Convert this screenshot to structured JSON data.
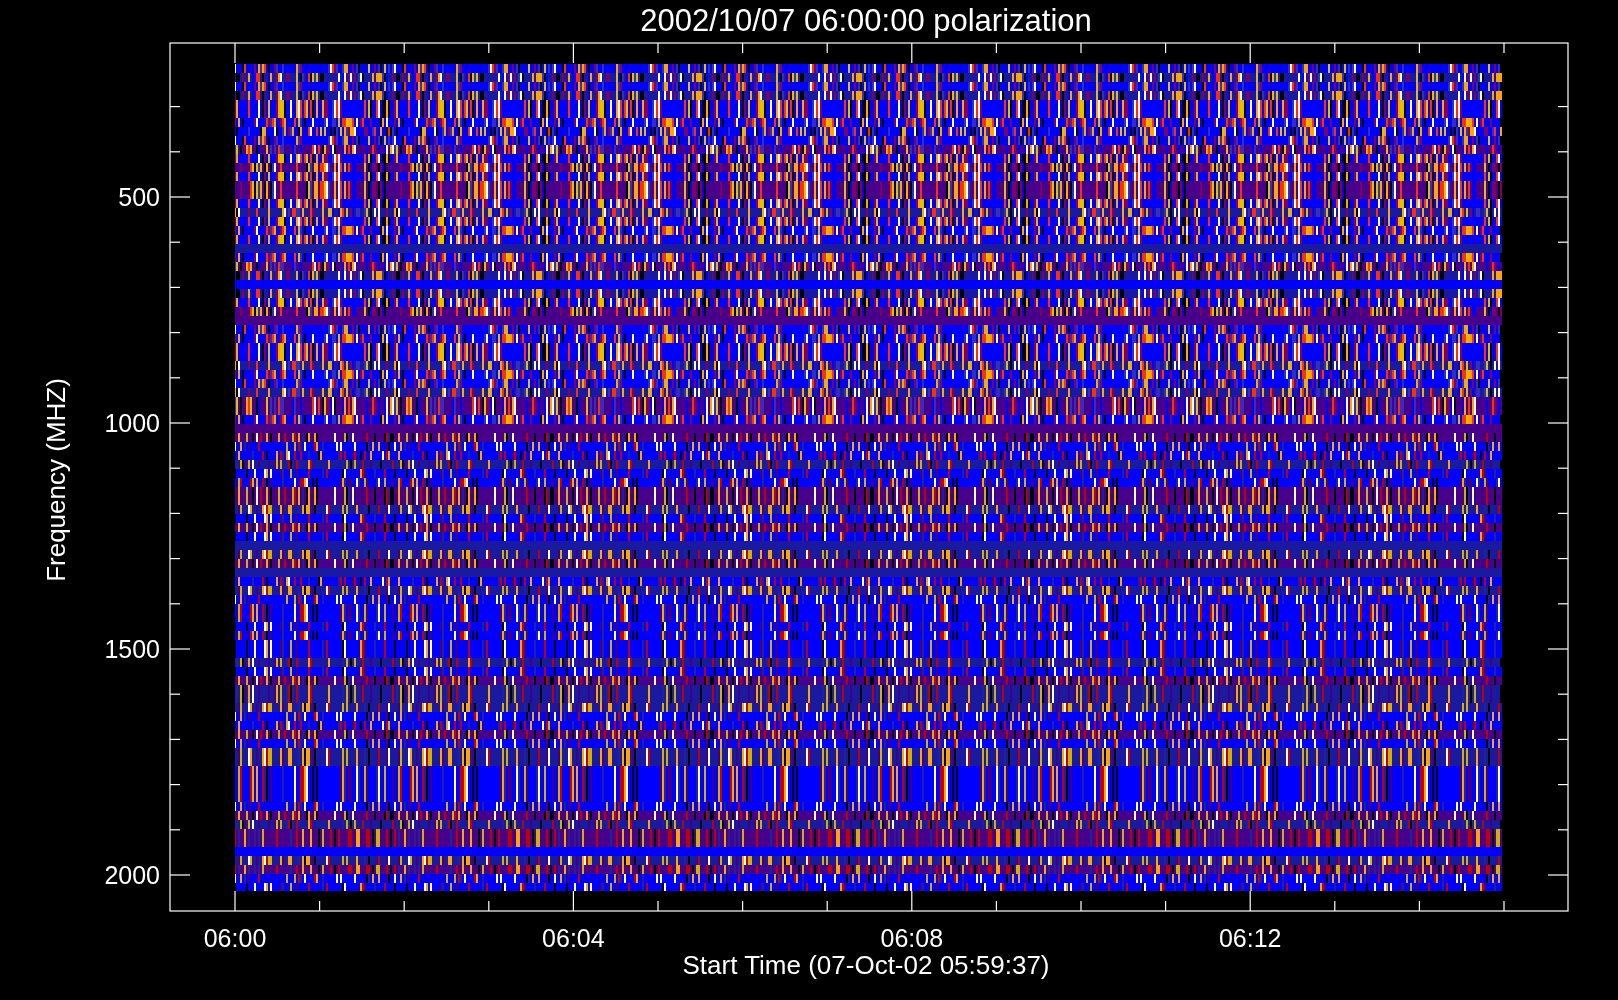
{
  "title": "2002/10/07 06:00:00 polarization",
  "y_axis": {
    "label": "Frequency (MHZ)",
    "ticks": [
      "500",
      "1000",
      "1500",
      "2000"
    ]
  },
  "x_axis": {
    "label": "Start Time (07-Oct-02 05:59:37)",
    "ticks": [
      "06:00",
      "06:04",
      "06:08",
      "06:12"
    ]
  }
}
